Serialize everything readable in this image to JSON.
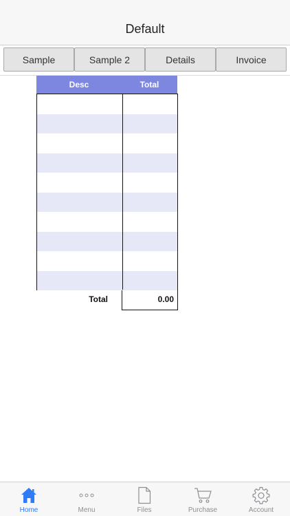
{
  "nav": {
    "title": "Default"
  },
  "tabs": [
    {
      "label": "Sample"
    },
    {
      "label": "Sample 2"
    },
    {
      "label": "Details"
    },
    {
      "label": "Invoice"
    }
  ],
  "sheet": {
    "columns": {
      "desc": "Desc",
      "total": "Total"
    },
    "total_label": "Total",
    "total_value": "0.00"
  },
  "tabbar": {
    "items": [
      {
        "label": "Home",
        "icon": "home-icon"
      },
      {
        "label": "Menu",
        "icon": "more-dots-icon"
      },
      {
        "label": "Files",
        "icon": "file-icon"
      },
      {
        "label": "Purchase",
        "icon": "cart-icon"
      },
      {
        "label": "Account",
        "icon": "gear-icon"
      }
    ],
    "active_color": "#2f7cf6",
    "inactive_color": "#8e8e93"
  },
  "colors": {
    "header_fill": "#7d87e0",
    "alt_row": "#e6e8f8"
  }
}
